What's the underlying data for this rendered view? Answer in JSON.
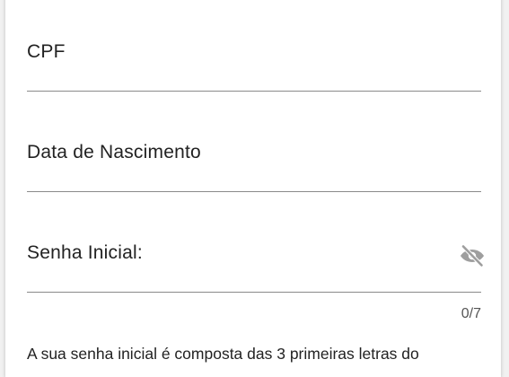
{
  "form": {
    "cpf": {
      "label": "CPF",
      "value": ""
    },
    "birth_date": {
      "label": "Data de Nascimento",
      "value": ""
    },
    "initial_password": {
      "label": "Senha Inicial:",
      "value": "",
      "counter": "0/7",
      "visibility_icon": "eye-off-icon"
    },
    "hint": "A sua senha inicial é composta das 3 primeiras letras do"
  },
  "colors": {
    "underline": "#8a8a8a",
    "icon": "#9e9e9e",
    "text": "#222222"
  }
}
